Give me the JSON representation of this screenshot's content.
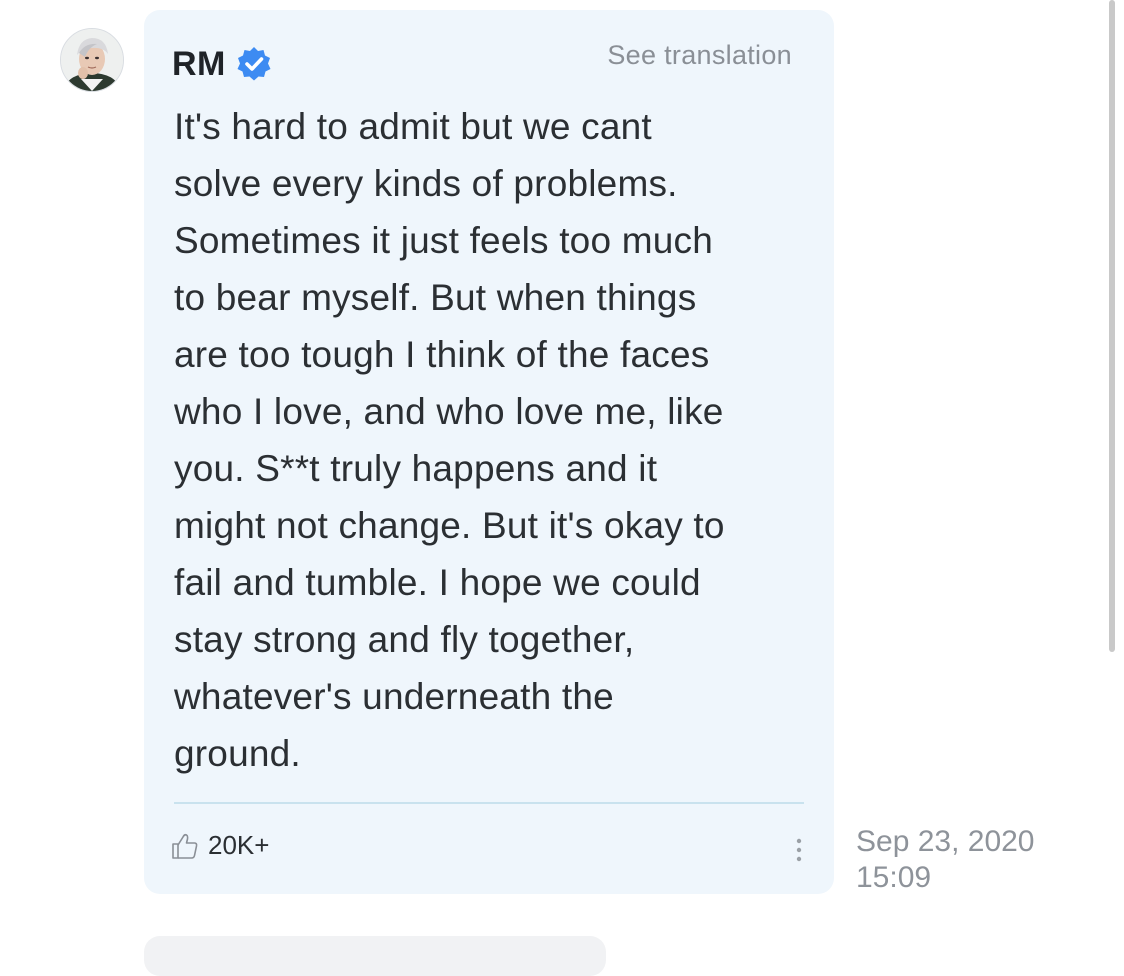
{
  "post": {
    "author": "RM",
    "verified_icon": "verified-badge-icon",
    "see_translation_label": "See translation",
    "body": "It's hard to admit but we cant\nsolve every kinds of problems.\nSometimes it just feels too much\nto bear myself. But when things\nare too tough I think of the faces\nwho I love, and who love me, like\nyou. S**t truly happens and it\nmight not change. But it's okay to\nfail and tumble. I hope we could\nstay strong and fly together,\nwhatever's underneath the\nground.",
    "like_icon": "thumbs-up-icon",
    "like_count": "20K+",
    "more_icon": "more-vertical-icon",
    "timestamp_date": "Sep 23, 2020",
    "timestamp_time": "15:09"
  },
  "colors": {
    "bubble_background": "#eff6fc",
    "verified_blue": "#3d8bf2",
    "divider": "#c9e2ee",
    "muted_text": "#8e939a",
    "body_text": "#2b2f33"
  }
}
